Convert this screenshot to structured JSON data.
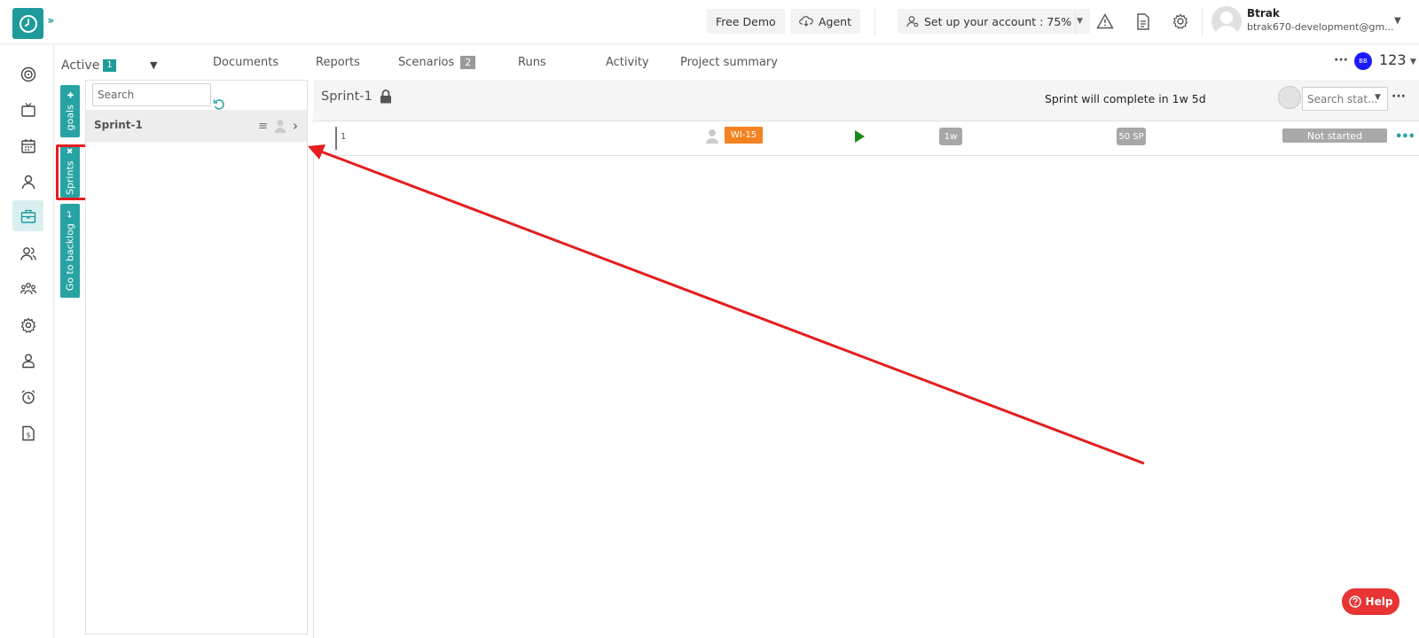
{
  "header": {
    "free_demo": "Free Demo",
    "agent": "Agent",
    "setup": "Set up your account : 75%",
    "user_name": "Btrak",
    "user_email": "btrak670-development@gm..."
  },
  "tabs": {
    "active_label": "Active",
    "active_count": "1",
    "items": [
      {
        "label": "Documents"
      },
      {
        "label": "Reports"
      },
      {
        "label": "Scenarios",
        "badge": "2"
      },
      {
        "label": "Runs"
      },
      {
        "label": "Activity"
      },
      {
        "label": "Project summary"
      }
    ],
    "avatar_initials": "BB",
    "project_number": "123"
  },
  "side_tabs": {
    "goals": "goals",
    "sprints": "Sprints",
    "backlog": "Go to backlog"
  },
  "sprint_list": {
    "search_placeholder": "Search",
    "items": [
      {
        "name": "Sprint-1"
      }
    ]
  },
  "sprint_detail": {
    "title": "Sprint-1",
    "completion_text": "Sprint will complete in 1w 5d",
    "status_search_placeholder": "Search stat...",
    "rows": [
      {
        "number": "1",
        "id": "WI-15",
        "estimate": "1w",
        "points": "50 SP",
        "status": "Not started"
      }
    ]
  },
  "help": {
    "label": "Help"
  },
  "colors": {
    "brand": "#1e9a9a",
    "wi_badge": "#f58220",
    "highlight": "#e41e1e",
    "help": "#e83434"
  }
}
